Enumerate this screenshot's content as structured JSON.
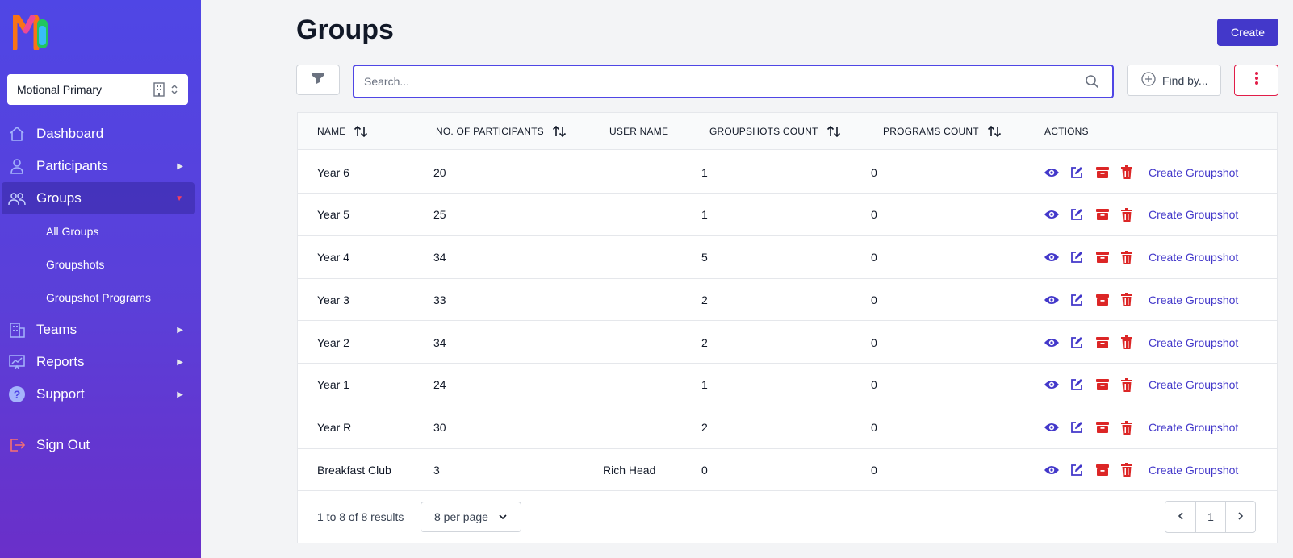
{
  "sidebar": {
    "org_select": {
      "value": "Motional Primary"
    },
    "nav": {
      "dashboard": "Dashboard",
      "participants": "Participants",
      "groups": "Groups",
      "groups_sub": [
        "All Groups",
        "Groupshots",
        "Groupshot Programs"
      ],
      "teams": "Teams",
      "reports": "Reports",
      "support": "Support",
      "signout": "Sign Out"
    }
  },
  "header": {
    "title": "Groups",
    "create_label": "Create"
  },
  "toolbar": {
    "search_placeholder": "Search...",
    "findby_label": "Find by..."
  },
  "table": {
    "columns": [
      "NAME",
      "NO. OF PARTICIPANTS",
      "USER NAME",
      "GROUPSHOTS COUNT",
      "PROGRAMS COUNT",
      "ACTIONS"
    ],
    "action_link": "Create Groupshot",
    "rows": [
      {
        "name": "Year 6",
        "participants": "20",
        "user": "",
        "groupshots": "1",
        "programs": "0"
      },
      {
        "name": "Year 5",
        "participants": "25",
        "user": "",
        "groupshots": "1",
        "programs": "0"
      },
      {
        "name": "Year 4",
        "participants": "34",
        "user": "",
        "groupshots": "5",
        "programs": "0"
      },
      {
        "name": "Year 3",
        "participants": "33",
        "user": "",
        "groupshots": "2",
        "programs": "0"
      },
      {
        "name": "Year 2",
        "participants": "34",
        "user": "",
        "groupshots": "2",
        "programs": "0"
      },
      {
        "name": "Year 1",
        "participants": "24",
        "user": "",
        "groupshots": "1",
        "programs": "0"
      },
      {
        "name": "Year R",
        "participants": "30",
        "user": "",
        "groupshots": "2",
        "programs": "0"
      },
      {
        "name": "Breakfast Club",
        "participants": "3",
        "user": "Rich Head",
        "groupshots": "0",
        "programs": "0"
      }
    ]
  },
  "pagination": {
    "results": "1 to 8 of 8 results",
    "per_page": "8 per page",
    "current_page": "1"
  },
  "colors": {
    "accent": "#4338ca",
    "danger": "#dc2626",
    "sidebar_top": "#4f46e5",
    "sidebar_bottom": "#6a2fc9"
  }
}
